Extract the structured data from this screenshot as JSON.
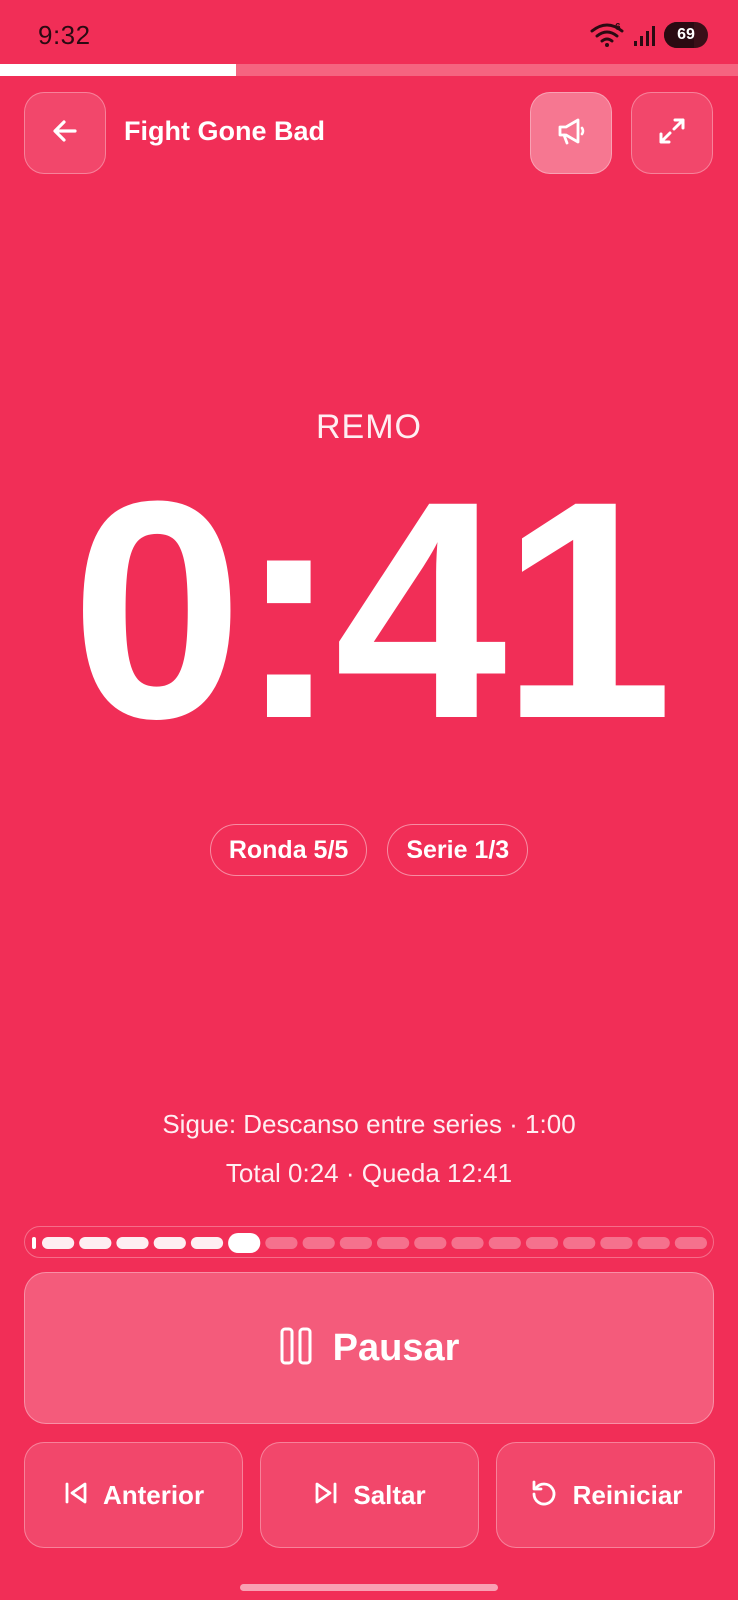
{
  "status_bar": {
    "time": "9:32",
    "wifi_badge": "6",
    "battery": "69",
    "battery_level": 0.69,
    "icons": [
      "wifi-icon",
      "signal-icon",
      "battery-icon"
    ]
  },
  "workout_progress": 0.32,
  "header": {
    "title": "Fight Gone Bad",
    "back_icon": "arrow-left-icon",
    "announce_icon": "megaphone-icon",
    "announce_active": true,
    "expand_icon": "expand-icon"
  },
  "timer": {
    "phase": "REMO",
    "time": "0:41"
  },
  "chips": [
    {
      "label": "Ronda 5/5"
    },
    {
      "label": "Serie 1/3"
    }
  ],
  "info": {
    "next": "Sigue: Descanso entre series · 1:00",
    "total": "Total 0:24 · Queda 12:41"
  },
  "intervals": {
    "total": 18,
    "current": 5,
    "states": [
      "done",
      "done",
      "done",
      "done",
      "done",
      "current",
      "pending",
      "pending",
      "pending",
      "pending",
      "pending",
      "pending",
      "pending",
      "pending",
      "pending",
      "pending",
      "pending",
      "pending"
    ]
  },
  "controls": {
    "pause": {
      "label": "Pausar",
      "icon": "pause-icon"
    },
    "previous": {
      "label": "Anterior",
      "icon": "skip-previous-icon"
    },
    "skip": {
      "label": "Saltar",
      "icon": "skip-next-icon"
    },
    "reset": {
      "label": "Reiniciar",
      "icon": "restart-icon"
    }
  },
  "colors": {
    "background": "#F12E57",
    "foreground": "#FFFFFF",
    "status_text": "#2A0A12"
  }
}
